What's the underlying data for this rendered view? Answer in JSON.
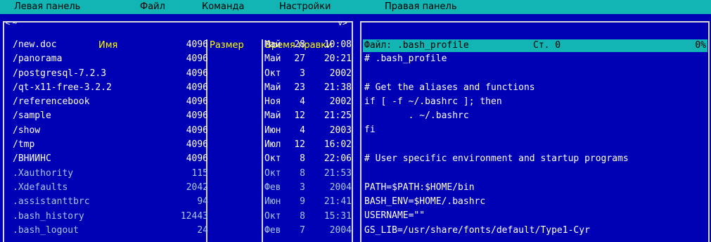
{
  "menubar": {
    "left_panel": "Левая панель",
    "file": "Файл",
    "command": "Команда",
    "settings": "Настройки",
    "right_panel": "Правая панель"
  },
  "left_panel": {
    "nav_left": "<",
    "nav_up": "~",
    "nav_right": "v>",
    "columns": {
      "name": "Имя",
      "size": "Размер",
      "mtime": "Время правки"
    },
    "rows": [
      {
        "name": "/new.doc",
        "size": "4096",
        "mon": "Май",
        "day": "28",
        "time": "10:08"
      },
      {
        "name": "/panorama",
        "size": "4096",
        "mon": "Май",
        "day": "27",
        "time": "20:21"
      },
      {
        "name": "/postgresql-7.2.3",
        "size": "4096",
        "mon": "Окт",
        "day": "3",
        "time": "2002"
      },
      {
        "name": "/qt-x11-free-3.2.2",
        "size": "4096",
        "mon": "Май",
        "day": "23",
        "time": "21:38"
      },
      {
        "name": "/referencebook",
        "size": "4096",
        "mon": "Ноя",
        "day": "4",
        "time": "2002"
      },
      {
        "name": "/sample",
        "size": "4096",
        "mon": "Май",
        "day": "12",
        "time": "21:25"
      },
      {
        "name": "/show",
        "size": "4096",
        "mon": "Июн",
        "day": "4",
        "time": "2003"
      },
      {
        "name": "/tmp",
        "size": "4096",
        "mon": "Июл",
        "day": "12",
        "time": "16:02"
      },
      {
        "name": "/ВНИИНС",
        "size": "4096",
        "mon": "Окт",
        "day": "8",
        "time": "22:06"
      },
      {
        "name": ".Xauthority",
        "size": "115",
        "mon": "Окт",
        "day": "8",
        "time": "21:53"
      },
      {
        "name": ".Xdefaults",
        "size": "2042",
        "mon": "Фев",
        "day": "3",
        "time": "2004"
      },
      {
        "name": ".assistanttbrc",
        "size": "94",
        "mon": "Июн",
        "day": "9",
        "time": "21:41"
      },
      {
        "name": ".bash_history",
        "size": "12443",
        "mon": "Окт",
        "day": "8",
        "time": "15:31"
      },
      {
        "name": ".bash_logout",
        "size": "24",
        "mon": "Фев",
        "day": "7",
        "time": "2004"
      }
    ]
  },
  "viewer": {
    "file_label": "Файл: .bash_profile",
    "line_label": "Ст. 0",
    "percent": "0%",
    "lines": [
      "# .bash_profile",
      "",
      "# Get the aliases and functions",
      "if [ -f ~/.bashrc ]; then",
      "        . ~/.bashrc",
      "fi",
      "",
      "# User specific environment and startup programs",
      "",
      "PATH=$PATH:$HOME/bin",
      "BASH_ENV=$HOME/.bashrc",
      "USERNAME=\"\"",
      "GS_LIB=/usr/share/fonts/default/Type1-Cyr"
    ]
  },
  "colors": {
    "panel_bg": "#0000b4",
    "menubar_bg": "#12b4b4",
    "header_text": "#ffff00",
    "text": "#ffffff"
  }
}
